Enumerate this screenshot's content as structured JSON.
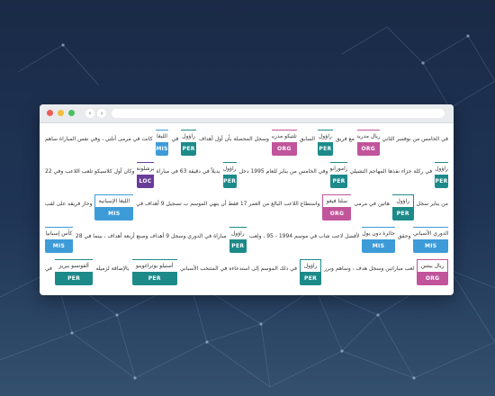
{
  "browser": {
    "back_glyph": "‹",
    "forward_glyph": "›"
  },
  "colors": {
    "PER": "#1d8a8a",
    "ORG": "#c1549a",
    "MIS": "#3d9bd8",
    "LOC": "#6a3c9a"
  },
  "lines": [
    [
      {
        "text": "في الخامس من نوفمبر الثاني"
      },
      {
        "word": "ريال مدريد",
        "type": "ORG"
      },
      {
        "text": "مع فريق"
      },
      {
        "word": "راؤول",
        "type": "PER"
      },
      {
        "text": "السابق"
      },
      {
        "word": "أتلتيكو مدريد",
        "type": "ORG"
      },
      {
        "text": "وسجل المحصلة بأن أول أهداف"
      },
      {
        "word": "راؤول",
        "type": "PER"
      },
      {
        "text": "في"
      },
      {
        "word": "الليغا",
        "type": "MIS"
      },
      {
        "text": "كانت في مرمى أتلتي ، وفي نفس المباراة ساهم"
      }
    ],
    [
      {
        "word": "راؤول",
        "type": "PER"
      },
      {
        "text": "في ركلة جزاء نفذها المهاجم التشيلي"
      },
      {
        "word": "زامورانو",
        "type": "PER"
      },
      {
        "text": "وفي الخامس من يناير للعام 1995 دخل"
      },
      {
        "word": "راؤول",
        "type": "PER"
      },
      {
        "text": "بديلاً في دقيقة 63 في مباراة"
      },
      {
        "word": "برشلونة",
        "type": "LOC"
      },
      {
        "text": "وكان أول كلاسيكو تلعب اللاعب وفي 22"
      }
    ],
    [
      {
        "text": "من يناير سجل"
      },
      {
        "word": "راؤول",
        "type": "PER"
      },
      {
        "text": "هاتين في مرمى"
      },
      {
        "word": "سلتا فيغو",
        "type": "ORG"
      },
      {
        "text": "واستطاع اللاعب البالغ من العمر 17 فقط أن ينهي الموسم ب تسجيل 9 أهداف في"
      },
      {
        "word": "الليغا الإسبانية",
        "type": "MIS"
      },
      {
        "text": "وحاز فريقه على لقب"
      }
    ],
    [
      {
        "word": "الدوري الأسباني",
        "type": "MIS"
      },
      {
        "text": "وحقق"
      },
      {
        "word": "جائزة دون بول",
        "type": "MIS"
      },
      {
        "text": "لأفضل لاعب شاب في موسم 1994 - 95 ، ولعب"
      },
      {
        "word": "راؤول",
        "type": "PER"
      },
      {
        "text": "28 مباراة في الدوري وسجل 9 أهداف وصنع أربعة أهداف ، بينما في"
      },
      {
        "word": "كأس إسبانيا",
        "type": "MIS"
      }
    ],
    [
      {
        "word": "ريال بيتس",
        "type": "ORG"
      },
      {
        "text": "لعب مباراتين وسجل هدف ، وساهم وبرز"
      },
      {
        "word": "راؤول",
        "type": "PER"
      },
      {
        "text": "في ذلك الموسم إلى استدعاءه في المنتخب الأسباني"
      },
      {
        "word": "أستيلو بوتراغوينو",
        "type": "PER"
      },
      {
        "text": "بالإضافة لزميله"
      },
      {
        "word": "ألفونسو بيريز",
        "type": "PER"
      },
      {
        "text": "في"
      }
    ]
  ]
}
